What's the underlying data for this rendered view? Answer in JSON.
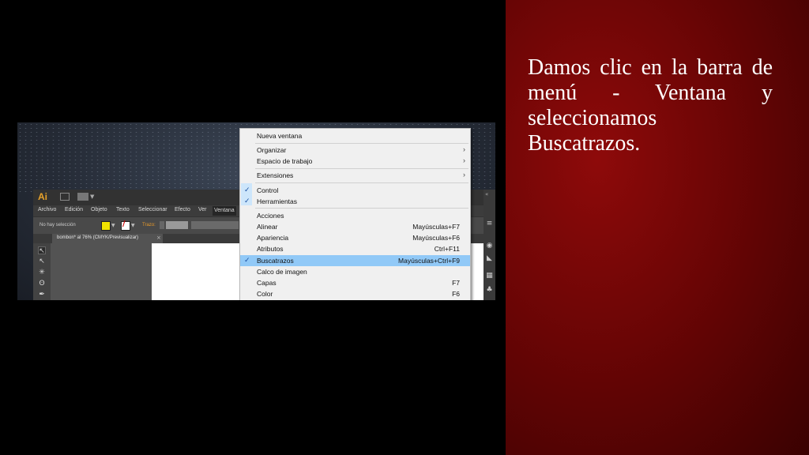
{
  "caption": "Damos clic en la barra de menú - Ventana y seleccionamos Buscatrazos.",
  "app": {
    "logo": "Ai",
    "menus": [
      "Archivo",
      "Edición",
      "Objeto",
      "Texto",
      "Seleccionar",
      "Efecto",
      "Ver",
      "Ventana"
    ],
    "control_bar": {
      "no_selection": "No hay selección",
      "stroke_label": "Trazo:"
    },
    "document_tab": {
      "label": "bombon* al 76% (CMYK/Previsualizar)",
      "close": "×"
    },
    "colors": {
      "fill": "#f2e400",
      "accent": "#e8a22a"
    }
  },
  "ventana_menu": {
    "items": [
      {
        "label": "Nueva ventana"
      },
      {
        "label": "Organizar",
        "submenu": true
      },
      {
        "label": "Espacio de trabajo",
        "submenu": true
      },
      {
        "label": "Extensiones",
        "submenu": true
      },
      {
        "label": "Control",
        "checked": true
      },
      {
        "label": "Herramientas",
        "checked": true
      },
      {
        "label": "Acciones"
      },
      {
        "label": "Alinear",
        "shortcut": "Mayúsculas+F7"
      },
      {
        "label": "Apariencia",
        "shortcut": "Mayúsculas+F6"
      },
      {
        "label": "Atributos",
        "shortcut": "Ctrl+F11"
      },
      {
        "label": "Buscatrazos",
        "shortcut": "Mayúsculas+Ctrl+F9",
        "checked": true,
        "highlighted": true
      },
      {
        "label": "Calco de imagen"
      },
      {
        "label": "Capas",
        "shortcut": "F7"
      },
      {
        "label": "Color",
        "shortcut": "F6"
      }
    ],
    "submenu_arrow": "›",
    "check_mark": "✓"
  }
}
